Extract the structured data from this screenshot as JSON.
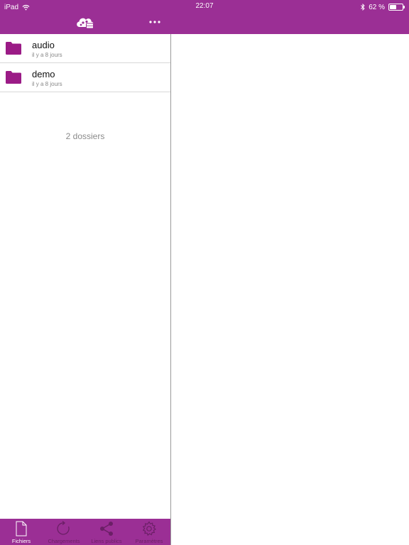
{
  "status_bar": {
    "device": "iPad",
    "time": "22:07",
    "battery": "62 %",
    "battery_level": 0.62
  },
  "header": {
    "logo_icon": "cloud-app-logo-icon",
    "more_icon": "more-options-icon"
  },
  "folders": [
    {
      "name": "audio",
      "modified": "il y a 8 jours"
    },
    {
      "name": "demo",
      "modified": "il y a 8 jours"
    }
  ],
  "folder_count": "2 dossiers",
  "tabs": [
    {
      "label": "Fichiers",
      "icon": "file-icon",
      "active": true
    },
    {
      "label": "Chargements",
      "icon": "refresh-icon",
      "active": false
    },
    {
      "label": "Liens publics",
      "icon": "share-icon",
      "active": false
    },
    {
      "label": "Paramètres",
      "icon": "gear-icon",
      "active": false
    }
  ],
  "colors": {
    "accent": "#9b2f95",
    "tab_inactive": "#6b1f66"
  }
}
